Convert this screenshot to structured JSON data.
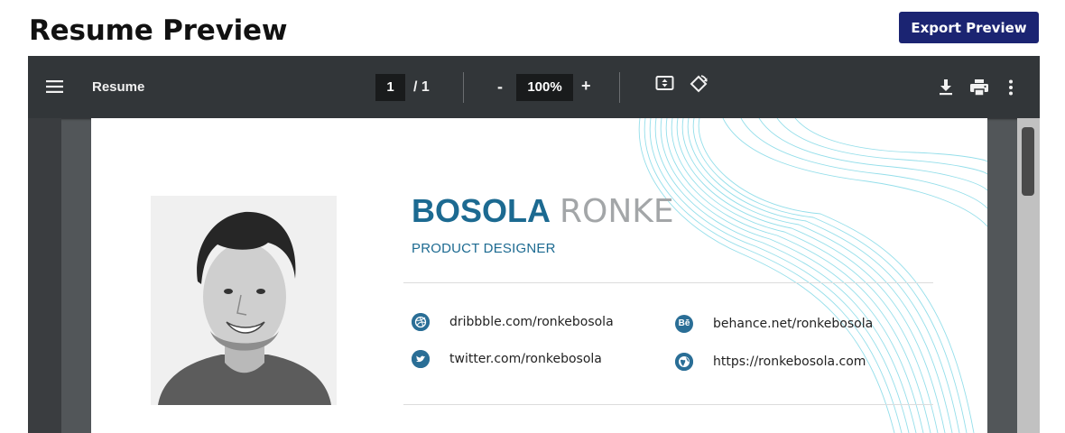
{
  "page": {
    "title": "Resume Preview",
    "export_label": "Export Preview"
  },
  "viewer": {
    "document_name": "Resume",
    "current_page": "1",
    "page_total": "/ 1",
    "zoom": "100%",
    "zoom_out": "-",
    "zoom_in": "+"
  },
  "resume": {
    "first_name": "BOSOLA",
    "last_name": "RONKE",
    "role": "PRODUCT DESIGNER",
    "contacts": {
      "dribbble": "dribbble.com/ronkebosola",
      "behance": "behance.net/ronkebosola",
      "behance_badge": "Bē",
      "twitter": "twitter.com/ronkebosola",
      "website": "https://ronkebosola.com"
    },
    "accent_color": "#1c6a91",
    "icon_color": "#2a6e96"
  }
}
